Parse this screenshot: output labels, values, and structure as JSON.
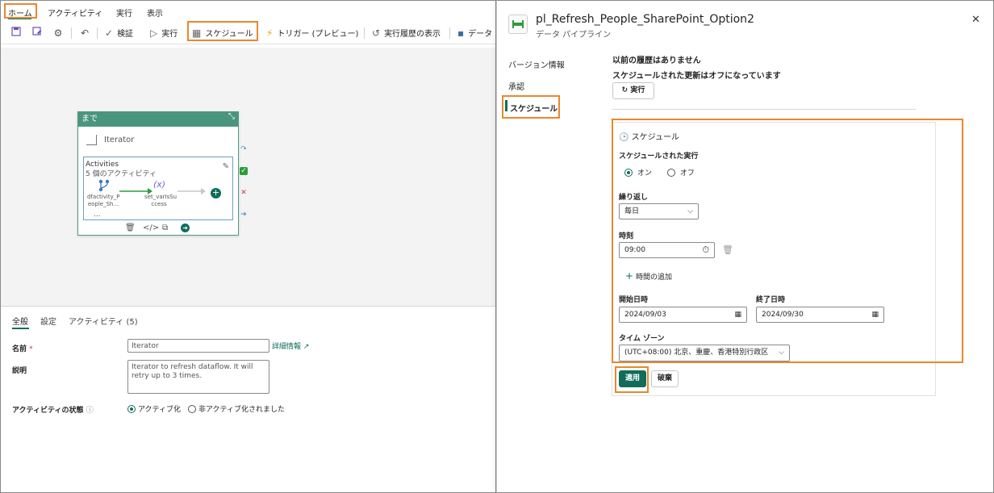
{
  "menu": {
    "items": [
      "ホーム",
      "アクティビティ",
      "実行",
      "表示"
    ]
  },
  "toolbar": {
    "validate": "検証",
    "run": "実行",
    "schedule": "スケジュール",
    "trigger": "トリガー (プレビュー)",
    "run_history": "実行履歴の表示",
    "data": "データ"
  },
  "card": {
    "header": "まで",
    "title": "Iterator",
    "inner_title": "Activities",
    "inner_subtitle": "5 個のアクティビティ",
    "node1": "dfactivity_P eople_Sh...",
    "node2": "set_varIsSu ccess",
    "node2_symbol": "(x)",
    "more": "..."
  },
  "properties": {
    "tabs": [
      "全般",
      "設定",
      "アクティビティ (5)"
    ],
    "name_label": "名前",
    "required_mark": "*",
    "name_value": "Iterator",
    "more_info": "詳細情報",
    "desc_label": "説明",
    "desc_value": "Iterator to refresh dataflow. It will retry up to 3 times.",
    "state_label": "アクティビティの状態",
    "state_active": "アクティブ化",
    "state_inactive": "非アクティブ化されました"
  },
  "panel": {
    "title": "pl_Refresh_People_SharePoint_Option2",
    "subtitle": "データ パイプライン",
    "nav": [
      "バージョン情報",
      "承認",
      "スケジュール"
    ],
    "no_history": "以前の履歴はありません",
    "refresh_off": "スケジュールされた更新はオフになっています",
    "run_button": "実行",
    "schedule": {
      "heading": "スケジュール",
      "scheduled_run_label": "スケジュールされた実行",
      "on": "オン",
      "off": "オフ",
      "repeat_label": "繰り返し",
      "repeat_value": "毎日",
      "time_label": "時刻",
      "time_value": "09:00",
      "add_time": "時間の追加",
      "start_label": "開始日時",
      "start_value": "2024/09/03",
      "end_label": "終了日時",
      "end_value": "2024/09/30",
      "timezone_label": "タイム ゾーン",
      "timezone_value": "(UTC+08:00) 北京、重慶、香港特別行政区"
    },
    "apply": "適用",
    "discard": "破棄"
  },
  "colors": {
    "accent": "#0f6d5a",
    "highlight": "#e8882d",
    "card_header": "#4a957e"
  }
}
